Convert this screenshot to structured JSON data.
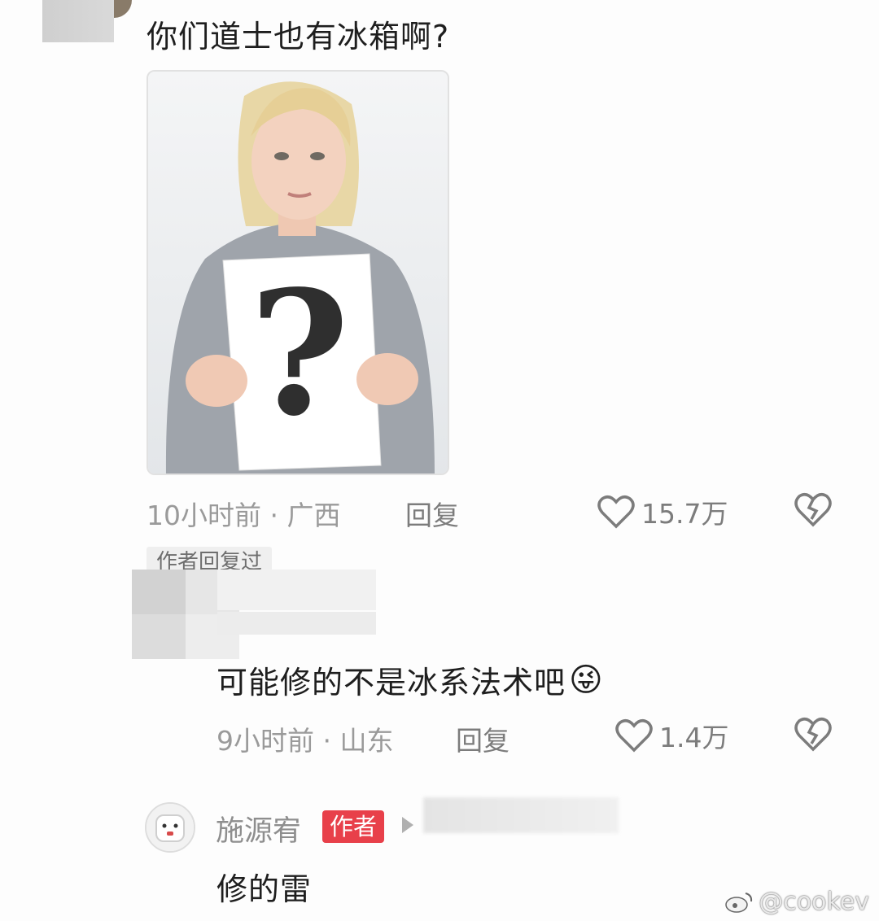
{
  "comment1": {
    "text": "你们道士也有冰箱啊?",
    "time_location": "10小时前 · 广西",
    "reply_label": "回复",
    "likes": "15.7万"
  },
  "author_replied_tag": "作者回复过",
  "comment2": {
    "text": "可能修的不是冰系法术吧",
    "emoji": "😜",
    "time_location": "9小时前 · 山东",
    "reply_label": "回复",
    "likes": "1.4万"
  },
  "comment3": {
    "username": "施源宥",
    "badge": "作者",
    "text": "修的雷"
  },
  "watermark": "@cookev",
  "colors": {
    "badge": "#e8404a",
    "meta": "#9a9a9a"
  }
}
